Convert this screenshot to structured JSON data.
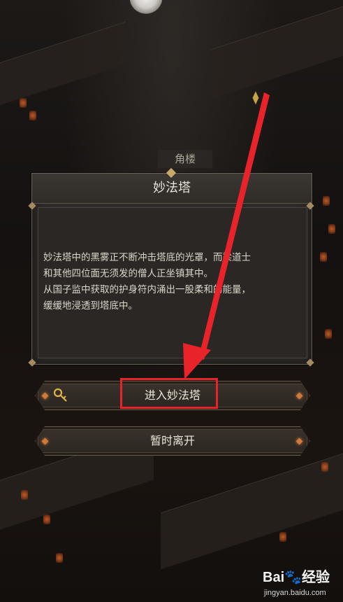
{
  "scene": {
    "location_label": "角楼",
    "marker_icon": "location-marker-icon"
  },
  "dialog": {
    "title": "妙法塔",
    "description": [
      "妙法塔中的黑雾正不断冲击塔底的光罩，而梁道士",
      "和其他四位面无须发的僧人正坐镇其中。",
      "从国子监中获取的护身符内涌出一股柔和的能量，",
      "缓缓地浸透到塔底中。"
    ]
  },
  "buttons": {
    "enter_label": "进入妙法塔",
    "enter_icon": "key-icon",
    "leave_label": "暂时离开"
  },
  "annotation": {
    "color": "#e8242a"
  },
  "watermark": {
    "logo": "Bai🐾经验",
    "site": "jingyan.baidu.com"
  }
}
